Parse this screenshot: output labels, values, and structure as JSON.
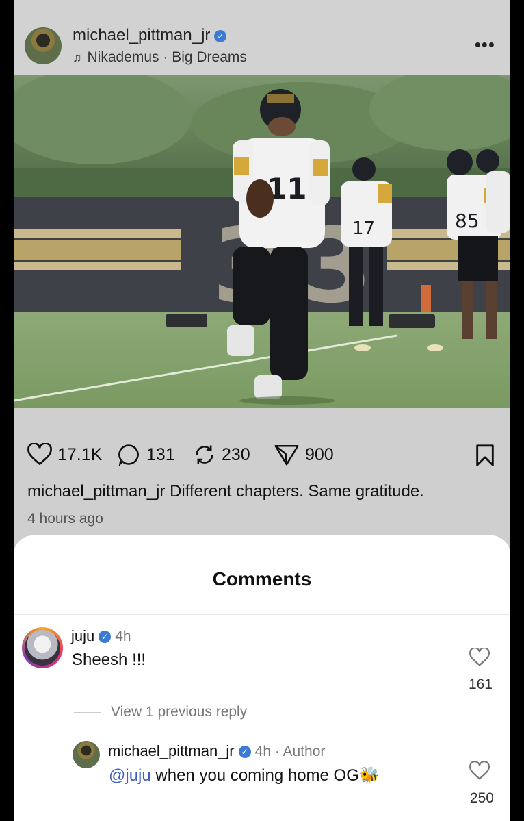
{
  "post": {
    "username": "michael_pittman_jr",
    "music": "Nikademus · Big Dreams",
    "more_icon": "more-horizontal-icon"
  },
  "actions": {
    "likes": "17.1K",
    "comments": "131",
    "reposts": "230",
    "shares": "900"
  },
  "caption": {
    "username": "michael_pittman_jr",
    "text": "Different chapters. Same gratitude.",
    "time": "4 hours ago"
  },
  "comments_sheet": {
    "title": "Comments",
    "comments": [
      {
        "username": "juju",
        "time": "4h",
        "text": "Sheesh !!!",
        "likes": "161"
      }
    ],
    "view_replies_label": "View 1 previous reply",
    "reply": {
      "username": "michael_pittman_jr",
      "time": "4h · Author",
      "mention": "@juju",
      "text": "when you coming home OG🐝",
      "likes": "250"
    }
  },
  "colors": {
    "verified": "#3a7bd5",
    "mention": "#3f5fb8",
    "overlay": "#cfcfcf"
  }
}
